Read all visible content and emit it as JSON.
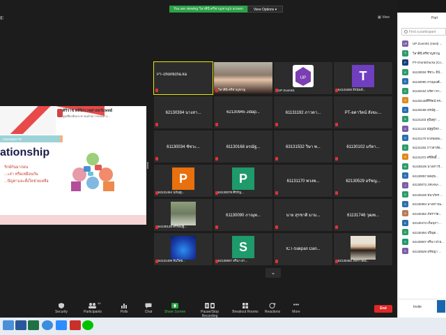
{
  "banner": {
    "message": "You are viewing วิลาศินี ศรีชาญชาญ's screen",
    "view_options": "View Options ▾"
  },
  "view_label": "View",
  "slide": {
    "logo_line1": "ศิริราช คลินิกเวชศาสตร์แพทย์",
    "logo_line2": "ศูนย์ฝึกเพื่อประชาชนด้วยการสอนทาง...",
    "tab": "แนะคุณภาพ",
    "title": "ationship",
    "line1": "รักษ์กันมาก่อน",
    "line2": "...ะสา หรือเหมือนกัน",
    "line3": "...ปัญหาและตั้งใจช่วยเหลือ"
  },
  "grid": [
    {
      "name": "PT-chonticha.ka",
      "active": true,
      "caption": "",
      "avatar": "",
      "photo": ""
    },
    {
      "name": "",
      "caption": "วิลาศินี ศรีชาญชาญ",
      "photo": "woman"
    },
    {
      "name": "",
      "caption": "UP Zoom01",
      "photo": "logo"
    },
    {
      "name": "",
      "caption": "64131500 ธีรนันท์...",
      "avatar": "T",
      "avatar_color": "#6f3fbf"
    },
    {
      "name": "62130394 นางสา...",
      "caption": ""
    },
    {
      "name": "62130945 Jidap...",
      "caption": ""
    },
    {
      "name": "61131192 ภาวดา...",
      "caption": ""
    },
    {
      "name": "PT-อดาวัตน์ สังฆะ...",
      "caption": ""
    },
    {
      "name": "61130034 ชัชวะ...",
      "caption": ""
    },
    {
      "name": "61130168 อรณัฐ...",
      "caption": ""
    },
    {
      "name": "63131532 วิษา พ...",
      "caption": ""
    },
    {
      "name": "61130102 มรัตา...",
      "caption": ""
    },
    {
      "name": "",
      "caption": "63131454 ปภัณฐ...",
      "avatar": "P",
      "avatar_color": "#e8700f"
    },
    {
      "name": "",
      "caption": "63130078 ศิรกัญ...",
      "avatar": "P",
      "avatar_color": "#1e9a6b"
    },
    {
      "name": "61131170 พวงพ...",
      "caption": ""
    },
    {
      "name": "62130529 อรัชญ...",
      "caption": ""
    },
    {
      "name": "",
      "caption": "64130135 ศรีรัตน์ฐิ...",
      "photo": "girl1"
    },
    {
      "name": "61130090 ภาณุพ...",
      "caption": ""
    },
    {
      "name": "นาย สุรชาติ มาม...",
      "caption": ""
    },
    {
      "name": "61131746 วุฒพ...",
      "caption": ""
    },
    {
      "name": "",
      "caption": "64131409 จีนวิทย...",
      "photo": "blue"
    },
    {
      "name": "",
      "caption": "62130507 สรินา ฝา...",
      "avatar": "S",
      "avatar_color": "#1e9a6b"
    },
    {
      "name": "ICT-Sakpan Dan...",
      "caption": ""
    },
    {
      "name": "",
      "caption": "62130462 ภัทราวัตน์...",
      "photo": "girl2"
    }
  ],
  "toolbar": {
    "security": "Security",
    "participants": "Participants",
    "participants_count": "49",
    "polls": "Polls",
    "chat": "Chat",
    "share": "Share Screen",
    "record": "Pause/Stop Recording",
    "breakout": "Breakout Rooms",
    "reactions": "Reactions",
    "more": "More",
    "end": "End"
  },
  "panel": {
    "title": "Part",
    "search_placeholder": "Find a participant",
    "invite": "Invite",
    "participants": [
      {
        "initials": "UP",
        "name": "UP Zoom01 (Host) ...",
        "color": "#7b5ea7"
      },
      {
        "initials": "วิ",
        "name": "วิลาศินี ศรีชาญชาญ",
        "color": "#2e9b6a"
      },
      {
        "initials": "P",
        "name": "PT-chonticha.ka (Co...",
        "color": "#1a3f7a"
      },
      {
        "initials": "6",
        "name": "61130034 ชัชวะ มีปั...",
        "color": "#2e9b6a"
      },
      {
        "initials": "6",
        "name": "61130090 ภาณุพงศ์...",
        "color": "#2a6fb0"
      },
      {
        "initials": "6",
        "name": "61130102 มรัตา หว...",
        "color": "#2e9b6a"
      },
      {
        "initials": "6",
        "name": "61130146ศิริรัตน์ ทร...",
        "color": "#e08a1e"
      },
      {
        "initials": "6",
        "name": "61130168 อรณัฐ ...",
        "color": "#2a6fb0"
      },
      {
        "initials": "6",
        "name": "61131103 สุนิษฐา ...",
        "color": "#2e9b6a"
      },
      {
        "initials": "6",
        "name": "61131123 ณัฐฐนิชา...",
        "color": "#7b5ea7"
      },
      {
        "initials": "6",
        "name": "61131170 พวงพยอม...",
        "color": "#2a6fb0"
      },
      {
        "initials": "6",
        "name": "61131192 ภาวดาลัย...",
        "color": "#2e9b6a"
      },
      {
        "initials": "6",
        "name": "61131372 ศรีสิทธิ์ ...",
        "color": "#e08a1e"
      },
      {
        "initials": "W",
        "name": "61430105 นางสาวรั...",
        "color": "#2e9b6a"
      },
      {
        "initials": "6",
        "name": "62130057 ตดสุข...",
        "color": "#2a6fb0"
      },
      {
        "initials": "J",
        "name": "62130073 JIRANA ...",
        "color": "#7b5ea7"
      },
      {
        "initials": "6",
        "name": "62130226 ชนาภัทร ...",
        "color": "#2e9b6a"
      },
      {
        "initials": "6",
        "name": "62130394 นางสาวณ...",
        "color": "#2a6fb0"
      },
      {
        "initials": "6",
        "name": "62130462 ภัทราวัต...",
        "color": "#b97a56"
      },
      {
        "initials": "6",
        "name": "62130473 เกิ่มพุกา ...",
        "color": "#2a6fb0"
      },
      {
        "initials": "6",
        "name": "62130494 ปริญุต...",
        "color": "#2e9b6a"
      },
      {
        "initials": "S",
        "name": "62130507 สรินา ฝ่าย...",
        "color": "#1e9a6b"
      },
      {
        "initials": "6",
        "name": "62130529 อรัชญา ...",
        "color": "#7b5ea7"
      }
    ]
  }
}
